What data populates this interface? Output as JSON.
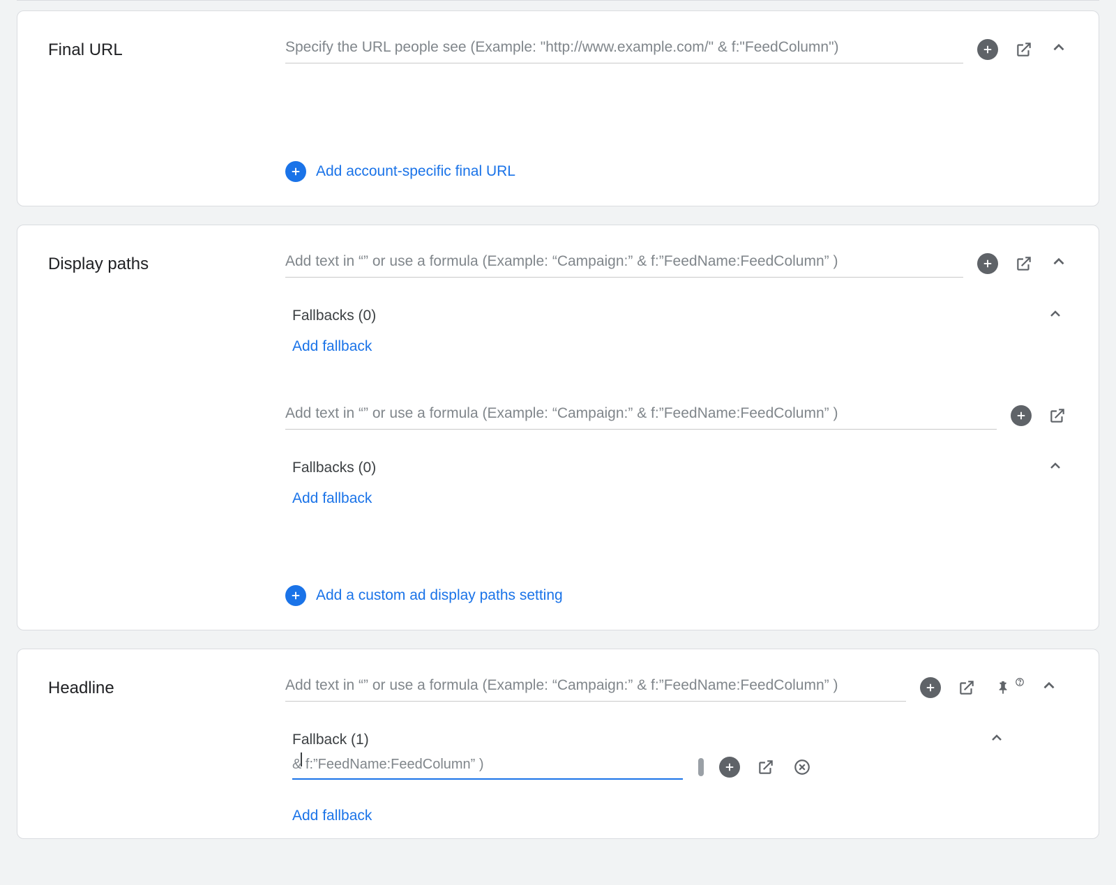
{
  "final_url": {
    "label": "Final URL",
    "placeholder": "Specify the URL people see (Example: \"http://www.example.com/\" & f:\"FeedColumn\")",
    "add_account_link": "Add account-specific final URL"
  },
  "display_paths": {
    "label": "Display paths",
    "path1_placeholder": "Add text in “” or use a formula (Example: “Campaign:” & f:”FeedName:FeedColumn” )",
    "path1_fallback_title": "Fallbacks (0)",
    "path1_fallback_add": "Add fallback",
    "path2_placeholder": "Add text in “” or use a formula (Example: “Campaign:” & f:”FeedName:FeedColumn” )",
    "path2_fallback_title": "Fallbacks (0)",
    "path2_fallback_add": "Add fallback",
    "add_custom_link": "Add a custom ad display paths setting"
  },
  "headline": {
    "label": "Headline",
    "placeholder": "Add text in “” or use a formula (Example: “Campaign:” & f:”FeedName:FeedColumn” )",
    "fallback_title": "Fallback (1)",
    "active_fallback_text": "& f:”FeedName:FeedColumn” )",
    "fallback_add": "Add fallback"
  }
}
